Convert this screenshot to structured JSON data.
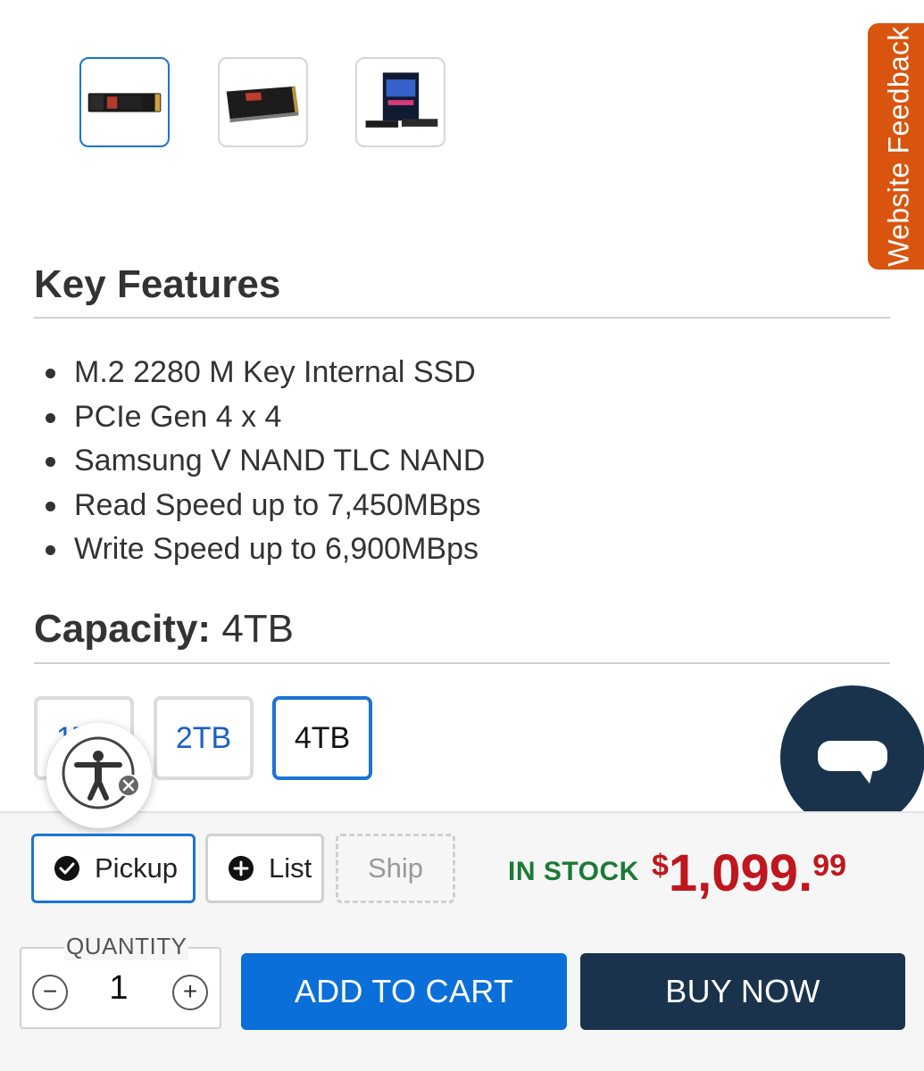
{
  "feedback_tab": {
    "label": "Website Feedback",
    "color": "#d9550f"
  },
  "gallery": {
    "thumbnails": [
      {
        "icon": "ssd-top-view-image",
        "selected": true
      },
      {
        "icon": "ssd-angled-view-image",
        "selected": false
      },
      {
        "icon": "ssd-packaging-image",
        "selected": false
      }
    ]
  },
  "key_features": {
    "title": "Key Features",
    "items": [
      "M.2 2280 M Key Internal SSD",
      "PCIe Gen 4 x 4",
      "Samsung V NAND TLC NAND",
      "Read Speed up to 7,450MBps",
      "Write Speed up to 6,900MBps"
    ]
  },
  "capacity": {
    "label": "Capacity:",
    "value": "4TB",
    "options": [
      {
        "label": "1TB",
        "selected": false
      },
      {
        "label": "2TB",
        "selected": false
      },
      {
        "label": "4TB",
        "selected": true
      }
    ]
  },
  "fulfillment": {
    "pickup_label": "Pickup",
    "list_label": "List",
    "ship_label": "Ship",
    "selected": "Pickup"
  },
  "stock_status": "IN STOCK",
  "price": {
    "currency": "$",
    "dollars": "1,099.",
    "cents": "99",
    "color": "#c0161d"
  },
  "quantity": {
    "label": "QUANTITY",
    "value": "1",
    "minus": "−",
    "plus": "+"
  },
  "actions": {
    "add_to_cart": "ADD TO CART",
    "buy_now": "BUY NOW"
  },
  "icons": {
    "accessibility": "accessibility-person-icon",
    "close": "close-icon",
    "chat": "chat-bubble-icon",
    "pickup": "check-circle-icon",
    "list": "plus-circle-icon"
  },
  "colors": {
    "accent": "#1b73d6",
    "navy": "#1a334d",
    "stock_green": "#1a7a34"
  }
}
